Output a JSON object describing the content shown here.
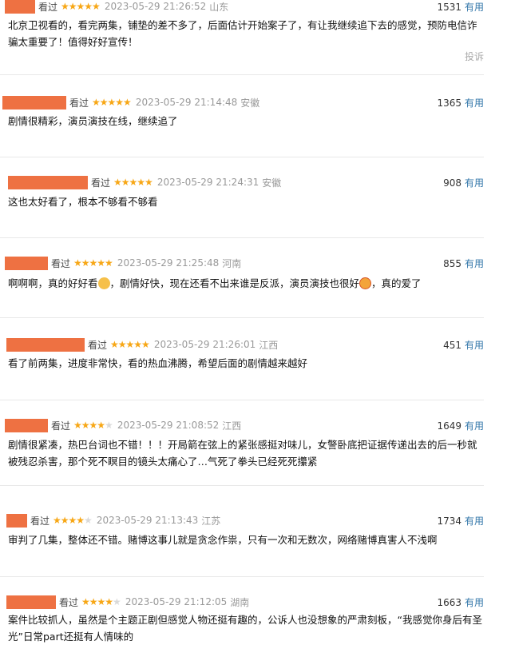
{
  "reviews": [
    {
      "status": "看过",
      "stars": "★★★★★",
      "time": "2023-05-29 21:26:52",
      "location": "山东",
      "count": "1531",
      "useful": "有用",
      "text": "北京卫视看的，看完两集，铺垫的差不多了，后面估计开始案子了，有让我继续追下去的感觉，预防电信诈骗太重要了！值得好好宣传！",
      "report": "投诉"
    },
    {
      "status": "看过",
      "stars": "★★★★★",
      "time": "2023-05-29 21:14:48",
      "location": "安徽",
      "count": "1365",
      "useful": "有用",
      "text": "剧情很精彩，演员演技在线，继续追了"
    },
    {
      "status": "看过",
      "stars": "★★★★★",
      "time": "2023-05-29 21:24:31",
      "location": "安徽",
      "count": "908",
      "useful": "有用",
      "text": "这也太好看了，根本不够看不够看"
    },
    {
      "status": "看过",
      "stars": "★★★★★",
      "time": "2023-05-29 21:25:48",
      "location": "河南",
      "count": "855",
      "useful": "有用",
      "text_a": "啊啊啊，真的好好看",
      "text_b": "，剧情好快，现在还看不出来谁是反派，演员演技也很好",
      "text_c": "，真的爱了"
    },
    {
      "status": "看过",
      "stars": "★★★★★",
      "time": "2023-05-29 21:26:01",
      "location": "江西",
      "count": "451",
      "useful": "有用",
      "text": "看了前两集，进度非常快，看的热血沸腾，希望后面的剧情越来越好"
    },
    {
      "status": "看过",
      "stars_on": "★★★★",
      "stars_off": "★",
      "time": "2023-05-29 21:08:52",
      "location": "江西",
      "count": "1649",
      "useful": "有用",
      "text": "剧情很紧凑，热巴台词也不错！！！开局箭在弦上的紧张感挺对味儿，女警卧底把证据传递出去的后一秒就被残忍杀害，那个死不瞑目的镜头太痛心了…气死了拳头已经死死攥紧"
    },
    {
      "status": "看过",
      "stars_on": "★★★★",
      "stars_off": "★",
      "time": "2023-05-29 21:13:43",
      "location": "江苏",
      "count": "1734",
      "useful": "有用",
      "text": "审判了几集，整体还不错。赌博这事儿就是贪念作祟，只有一次和无数次，网络赌博真害人不浅啊"
    },
    {
      "status": "看过",
      "stars_on": "★★★★",
      "stars_off": "★",
      "time": "2023-05-29 21:12:05",
      "location": "湖南",
      "count": "1663",
      "useful": "有用",
      "text": "案件比较抓人，虽然是个主题正剧但感觉人物还挺有趣的，公诉人也没想象的严肃刻板，“我感觉你身后有圣光”日常part还挺有人情味的"
    }
  ],
  "colors": {
    "redaction": "#ee7142",
    "star_on": "#f7a716",
    "star_off": "#d9d9d9",
    "link": "#3377aa"
  }
}
